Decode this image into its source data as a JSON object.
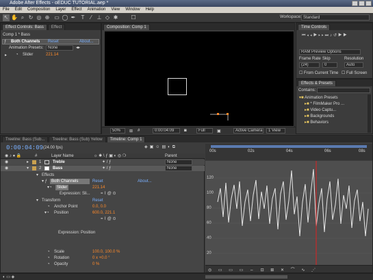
{
  "window": {
    "title": "Adobe After Effects - oEDUC TUTORIAL.aep *"
  },
  "menu": [
    "File",
    "Edit",
    "Composition",
    "Layer",
    "Effect",
    "Animation",
    "View",
    "Window",
    "Help"
  ],
  "workspace": {
    "label": "Workspace:",
    "value": "Standard"
  },
  "effect_controls": {
    "tabs": [
      "Effect Controls: Bass",
      "Effect"
    ],
    "breadcrumb": "Comp 1 * Bass",
    "effect_name": "Both Channels",
    "reset": "Reset",
    "about": "About...",
    "preset_label": "Animation Presets:",
    "preset_value": "None",
    "slider_label": "Slider",
    "slider_value": "221.14"
  },
  "composition": {
    "tab": "Composition: Comp 1",
    "zoom": "50%",
    "timecode": "0:00:04:09",
    "resolution": "Full",
    "camera": "Active Camera",
    "view": "1 View"
  },
  "time_controls": {
    "tab": "Time Controls",
    "ram_preview": "RAM Preview Options",
    "frame_rate_label": "Frame Rate",
    "skip_label": "Skip",
    "resolution_label": "Resolution",
    "frame_rate": "(24)",
    "skip": "0",
    "resolution": "Auto",
    "from_current": "From Current Time",
    "full_screen": "Full Screen"
  },
  "effects_presets": {
    "tab": "Effects & Presets",
    "search_label": "Contains:",
    "items": [
      "Animation Presets",
      "* FilmMaker Pro ...",
      "Video Captu...",
      "Backgrounds",
      "Behaviors"
    ]
  },
  "timeline": {
    "tabs": [
      "Treeline: Bass (Sub...",
      "Treeline: Bass (Sub) Yellow",
      "Timeline: Comp 1"
    ],
    "current_time": "0:00:04:09",
    "fps": "(24.00 fps)",
    "columns": {
      "layer_name": "Layer Name",
      "parent": "Parent"
    },
    "layers": [
      {
        "num": "1",
        "name": "Treble",
        "parent": "None"
      },
      {
        "num": "2",
        "name": "Bass",
        "parent": "None"
      }
    ],
    "props": {
      "effects": "Effects",
      "both_channels": "Both Channels",
      "reset": "Reset",
      "about": "About...",
      "slider": "Slider",
      "slider_value": "221.14",
      "expr_slider": "Expression: Sli...",
      "transform": "Transform",
      "transform_reset": "Reset",
      "anchor": "Anchor Point",
      "anchor_value": "0.0, 0.0",
      "position": "Position",
      "position_value": "600.0, 221.1",
      "expr_position": "Expression: Position",
      "scale": "Scale",
      "scale_value": "100.0, 100.0 %",
      "rotation": "Rotation",
      "rotation_value": "0 x +0.0 °",
      "opacity": "Opacity",
      "opacity_value": "0 %"
    },
    "ruler": [
      "00s",
      "02s",
      "04s",
      "06s",
      "08s"
    ],
    "graph_labels": [
      "120",
      "100",
      "80",
      "60",
      "40",
      "20"
    ]
  },
  "colors": {
    "accent_orange": "#ff8a2a",
    "timecode_blue": "#7ab0ff",
    "time_indicator": "#e02020"
  }
}
